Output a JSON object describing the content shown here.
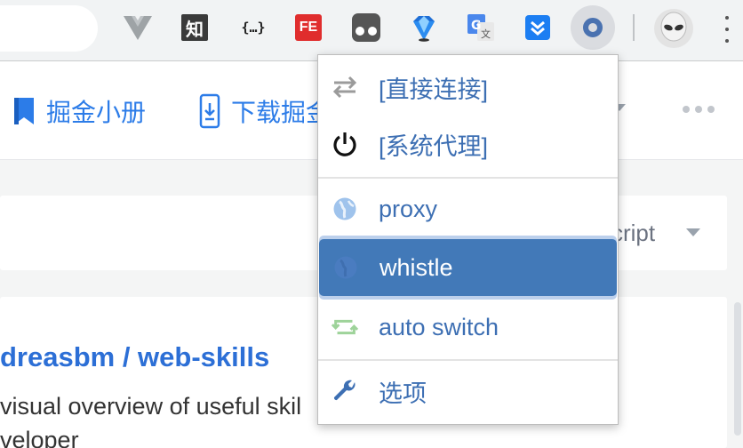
{
  "toolbar": {
    "extensions": [
      {
        "name": "vue-devtools",
        "icon": "v-logo"
      },
      {
        "name": "zhihu",
        "text": "知"
      },
      {
        "name": "json-viewer",
        "text": "{…}"
      },
      {
        "name": "fehelper",
        "text": "FE"
      },
      {
        "name": "eyes-ext",
        "icon": "eyes"
      },
      {
        "name": "sapphire-ext",
        "icon": "gem"
      },
      {
        "name": "google-translate",
        "text": "G"
      },
      {
        "name": "pocket-ext",
        "icon": "chevrons"
      },
      {
        "name": "switchyomega",
        "icon": "ring",
        "active": true
      }
    ],
    "accent": "#4a72b0"
  },
  "page": {
    "nav": {
      "items": [
        {
          "label": "掘金小册",
          "icon": "bookmark-icon"
        },
        {
          "label": "下载掘金",
          "icon": "phone-download-icon"
        }
      ]
    },
    "filter_text": "cript",
    "repo": {
      "title": "dreasbm / web-skills",
      "description_line1": "visual overview of useful skil",
      "description_line2": "veloper"
    }
  },
  "menu": {
    "items": [
      {
        "label": "[直接连接]",
        "icon": "direct-arrows-icon",
        "active": false
      },
      {
        "label": "[系统代理]",
        "icon": "power-icon",
        "active": false
      },
      {
        "label": "proxy",
        "icon": "globe-icon",
        "active": false
      },
      {
        "label": "whistle",
        "icon": "globe-icon",
        "active": true
      },
      {
        "label": "auto switch",
        "icon": "retweet-icon",
        "active": false
      },
      {
        "label": "选项",
        "icon": "wrench-icon",
        "active": false
      }
    ],
    "colors": {
      "text": "#3d6fb3",
      "active_bg": "#4279b8",
      "active_text": "#ffffff"
    }
  }
}
